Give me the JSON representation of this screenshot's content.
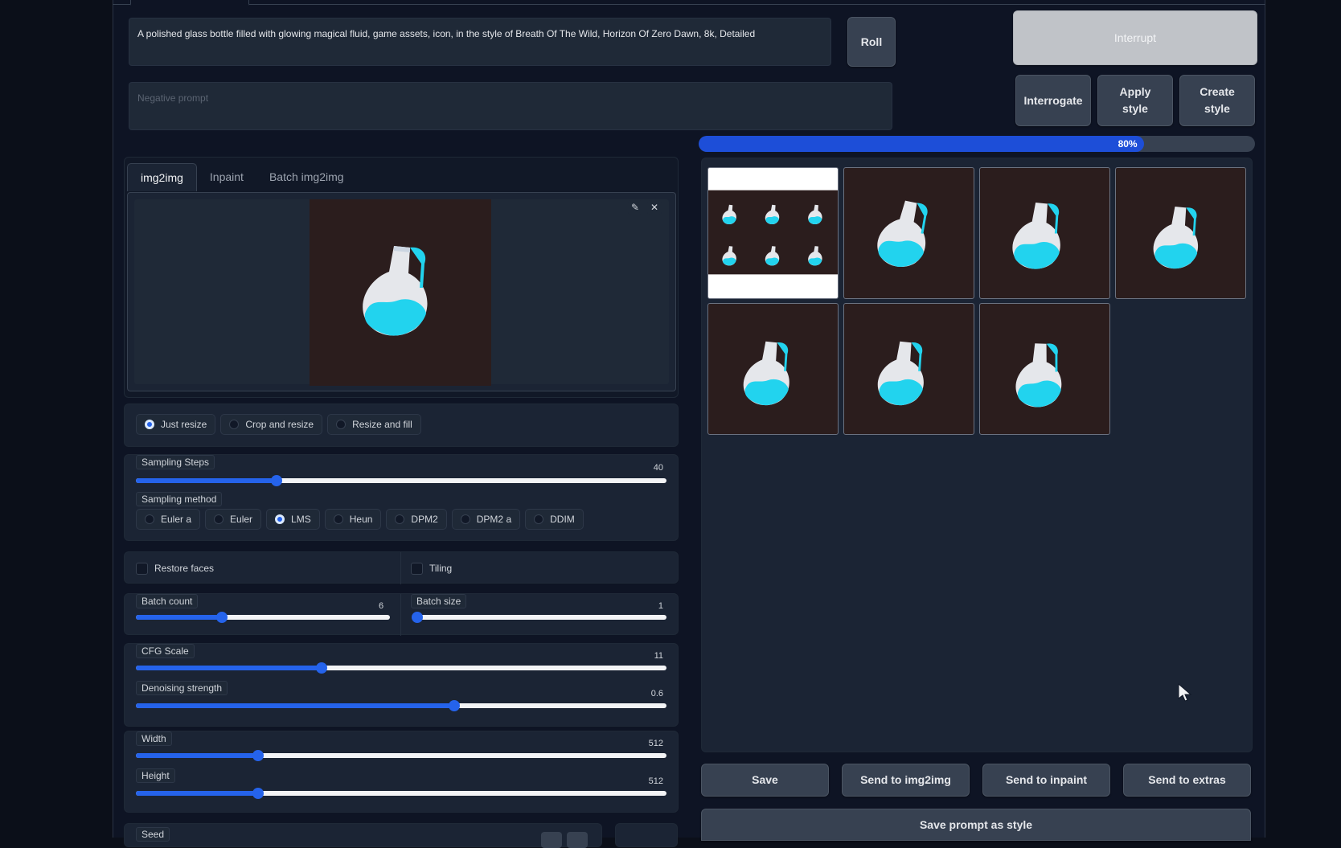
{
  "prompt": {
    "value": "A polished glass bottle filled with glowing magical fluid, game assets, icon, in the style of Breath Of The Wild, Horizon Of Zero Dawn, 8k, Detailed"
  },
  "negative_prompt": {
    "placeholder": "Negative prompt"
  },
  "buttons": {
    "roll": "Roll",
    "interrupt": "Interrupt",
    "interrogate": "Interrogate",
    "apply_style": "Apply style",
    "create_style": "Create style"
  },
  "progress": {
    "label": "80%",
    "fraction": 0.8,
    "color": "#1d4ed8"
  },
  "tabs": [
    {
      "label": "img2img"
    },
    {
      "label": "Inpaint"
    },
    {
      "label": "Batch img2img"
    }
  ],
  "resize_modes": [
    {
      "label": "Just resize",
      "selected": true
    },
    {
      "label": "Crop and resize",
      "selected": false
    },
    {
      "label": "Resize and fill",
      "selected": false
    }
  ],
  "sampling_steps": {
    "label": "Sampling Steps",
    "value": "40",
    "fraction": 0.265
  },
  "sampling_method": {
    "label": "Sampling method",
    "options": [
      {
        "label": "Euler a",
        "selected": false
      },
      {
        "label": "Euler",
        "selected": false
      },
      {
        "label": "LMS",
        "selected": true
      },
      {
        "label": "Heun",
        "selected": false
      },
      {
        "label": "DPM2",
        "selected": false
      },
      {
        "label": "DPM2 a",
        "selected": false
      },
      {
        "label": "DDIM",
        "selected": false
      }
    ]
  },
  "checks": {
    "restore_faces": "Restore faces",
    "tiling": "Tiling"
  },
  "batch_count": {
    "label": "Batch count",
    "value": "6",
    "fraction": 0.34
  },
  "batch_size": {
    "label": "Batch size",
    "value": "1",
    "fraction": 0.0
  },
  "cfg_scale": {
    "label": "CFG Scale",
    "value": "11",
    "fraction": 0.35
  },
  "denoising": {
    "label": "Denoising strength",
    "value": "0.6",
    "fraction": 0.6
  },
  "width": {
    "label": "Width",
    "value": "512",
    "fraction": 0.23
  },
  "height": {
    "label": "Height",
    "value": "512",
    "fraction": 0.23
  },
  "seed": {
    "label": "Seed"
  },
  "actions": {
    "save": "Save",
    "send_img2img": "Send to img2img",
    "send_inpaint": "Send to inpaint",
    "send_extras": "Send to extras",
    "save_prompt_style": "Save prompt as style"
  },
  "colors": {
    "accent": "#2563eb",
    "background": "#0b0f19",
    "liquid": "#22d3ee"
  },
  "icons": {
    "edit": "pencil-icon",
    "close": "close-icon",
    "cursor": "mouse-pointer-icon"
  }
}
